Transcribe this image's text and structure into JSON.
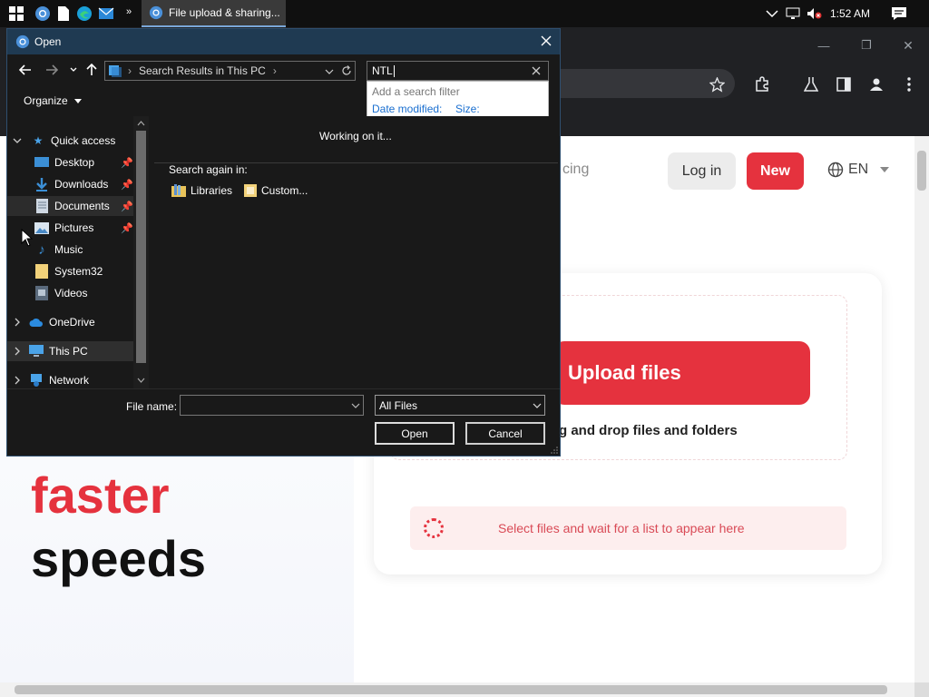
{
  "taskbar": {
    "active_task_label": "File upload & sharing...",
    "time": "1:52 AM",
    "icons": [
      "windows-start-icon",
      "chrome-icon",
      "file-icon",
      "edge-icon",
      "mail-icon",
      "overflow-chevrons-icon",
      "network-icon",
      "volume-muted-icon",
      "notification-icon"
    ]
  },
  "browser": {
    "controls": {
      "minimize": "—",
      "maximize": "❐",
      "close": "✕"
    },
    "nav": {
      "pricing_partial": "cing",
      "login": "Log in",
      "new": "New",
      "language": "EN"
    },
    "hero": {
      "line_red": "faster",
      "line_black": "speeds"
    },
    "upload": {
      "button": "Upload files",
      "drag_text": "g and drop files and folders",
      "empty_list": "Select files and wait for a list to appear here"
    },
    "colors": {
      "brand": "#e5323e",
      "list_bg": "#fdeeee"
    }
  },
  "dialog": {
    "title": "Open",
    "address": "Search Results in This PC",
    "search_value": "NTL",
    "search_dropdown": {
      "title": "Add a search filter",
      "filter_date": "Date modified:",
      "filter_size": "Size:"
    },
    "organize": "Organize",
    "sidebar": {
      "quick_access": "Quick access",
      "items": [
        {
          "label": "Desktop",
          "pinned": true
        },
        {
          "label": "Downloads",
          "pinned": true
        },
        {
          "label": "Documents",
          "pinned": true
        },
        {
          "label": "Pictures",
          "pinned": true
        },
        {
          "label": "Music",
          "pinned": false
        },
        {
          "label": "System32",
          "pinned": false
        },
        {
          "label": "Videos",
          "pinned": false
        }
      ],
      "onedrive": "OneDrive",
      "this_pc": "This PC",
      "network": "Network"
    },
    "status": "Working on it...",
    "search_again": {
      "label": "Search again in:",
      "libraries": "Libraries",
      "custom": "Custom..."
    },
    "file_name_label": "File name:",
    "file_name_value": "",
    "file_type": "All Files",
    "open_button": "Open",
    "cancel_button": "Cancel"
  }
}
